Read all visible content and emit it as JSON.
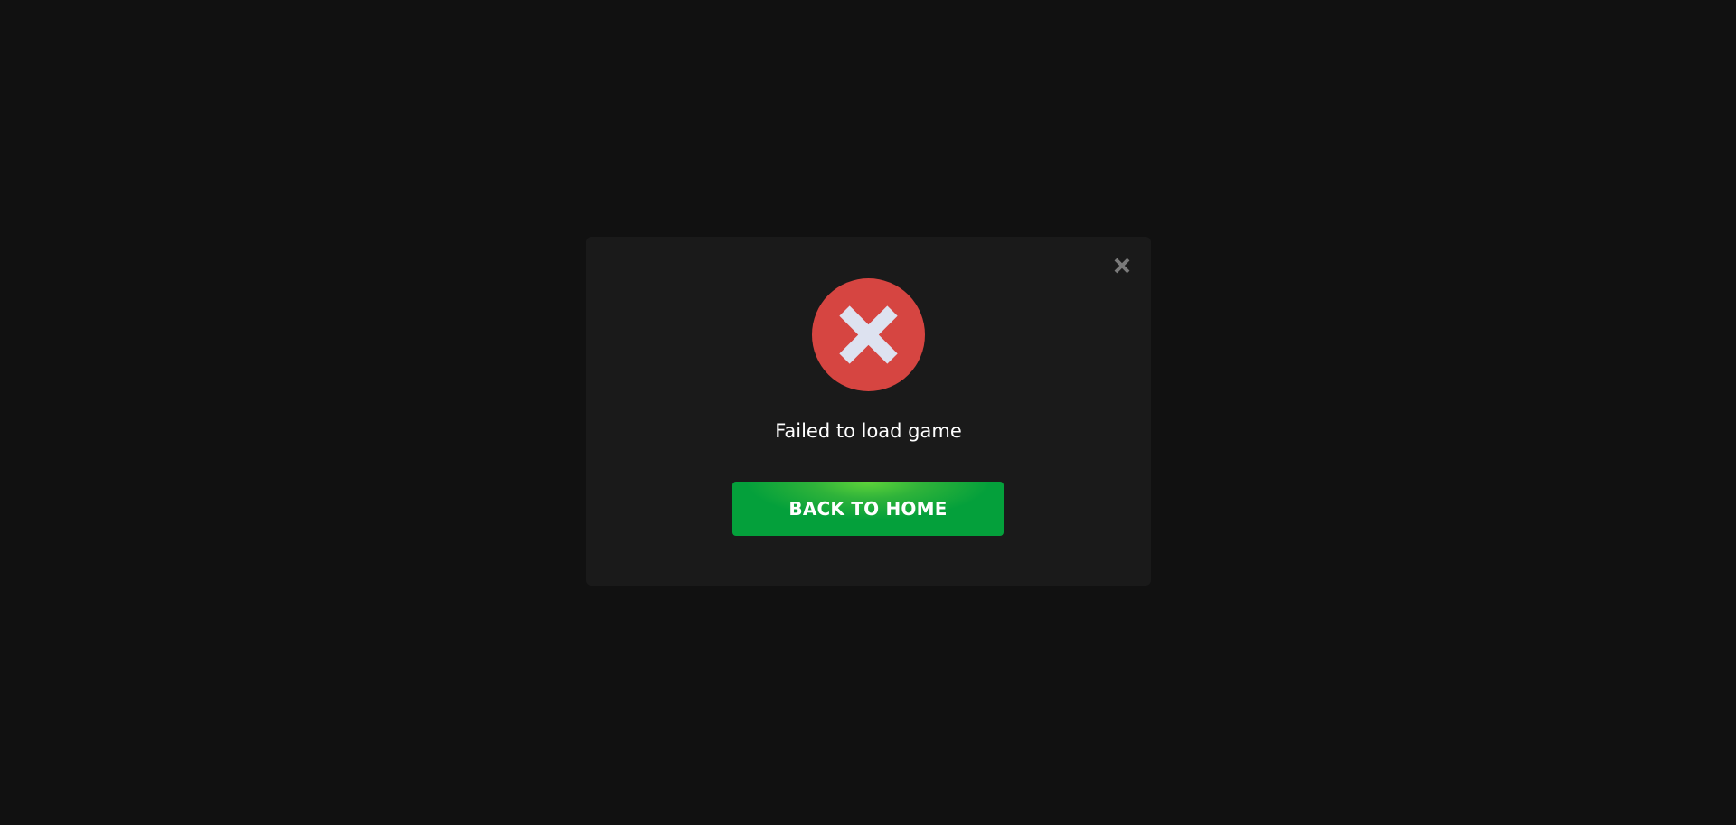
{
  "dialog": {
    "message": "Failed to load game",
    "primary_button_label": "BACK TO HOME",
    "status_icon": "error-x-circle-icon",
    "close_icon": "close-icon"
  },
  "colors": {
    "page_background": "#111111",
    "modal_background": "#1a1a1a",
    "error_circle": "#d64541",
    "error_cross": "#dde2f0",
    "button_green": "#04a03b",
    "button_highlight": "#5fd43a",
    "close_icon": "#7a7a7a"
  }
}
